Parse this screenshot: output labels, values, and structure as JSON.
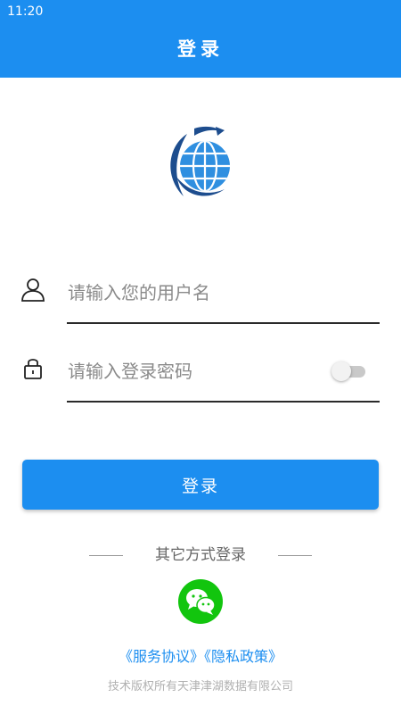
{
  "status_bar": {
    "time": "11:20"
  },
  "header": {
    "title": "登录"
  },
  "logo": {
    "icon": "globe-logo-icon"
  },
  "form": {
    "username": {
      "placeholder": "请输入您的用户名",
      "value": "",
      "icon": "user-icon"
    },
    "password": {
      "placeholder": "请输入登录密码",
      "value": "",
      "icon": "lock-icon",
      "show_password_toggle": "off"
    },
    "login_label": "登录"
  },
  "other_login": {
    "label": "其它方式登录",
    "wechat_icon": "wechat-icon"
  },
  "links": {
    "service_agreement": "《服务协议》",
    "privacy_policy": "《隐私政策》"
  },
  "footer": {
    "copyright": "技术版权所有天津津湖数据有限公司"
  },
  "colors": {
    "primary": "#1c8ef0",
    "wechat": "#12c50e"
  }
}
